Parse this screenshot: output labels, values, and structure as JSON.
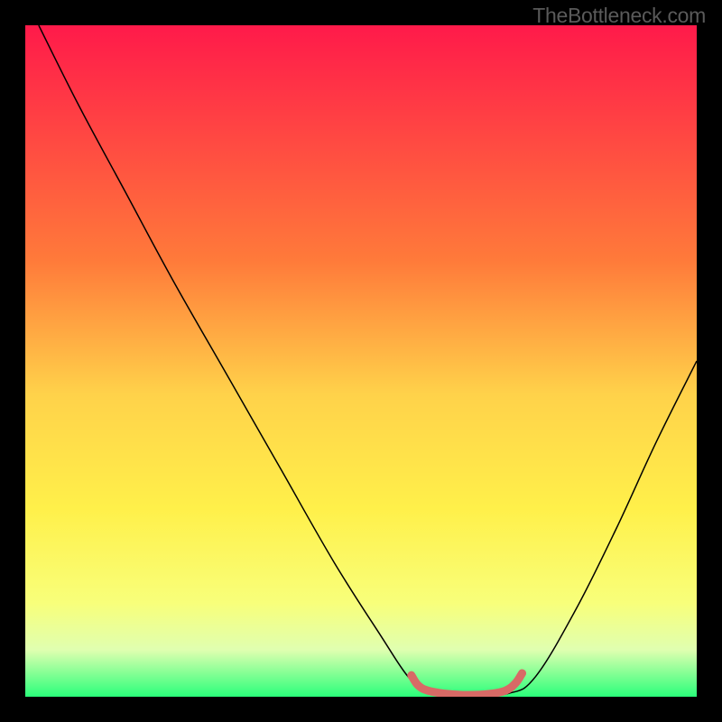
{
  "watermark": "TheBottleneck.com",
  "chart_data": {
    "type": "line",
    "title": "",
    "xlabel": "",
    "ylabel": "",
    "xlim": [
      0,
      100
    ],
    "ylim": [
      0,
      100
    ],
    "background_gradient": {
      "stops": [
        {
          "offset": 0,
          "color": "#ff1a4a"
        },
        {
          "offset": 35,
          "color": "#ff7a3a"
        },
        {
          "offset": 55,
          "color": "#ffd24a"
        },
        {
          "offset": 72,
          "color": "#fff04a"
        },
        {
          "offset": 86,
          "color": "#f8ff7a"
        },
        {
          "offset": 93,
          "color": "#e0ffb0"
        },
        {
          "offset": 100,
          "color": "#2aff7a"
        }
      ]
    },
    "series": [
      {
        "name": "bottleneck-curve",
        "type": "line",
        "color": "#000000",
        "width": 1.5,
        "points": [
          {
            "x": 2,
            "y": 100
          },
          {
            "x": 8,
            "y": 88
          },
          {
            "x": 15,
            "y": 75
          },
          {
            "x": 22,
            "y": 62
          },
          {
            "x": 30,
            "y": 48
          },
          {
            "x": 38,
            "y": 34
          },
          {
            "x": 46,
            "y": 20
          },
          {
            "x": 53,
            "y": 9
          },
          {
            "x": 57,
            "y": 3
          },
          {
            "x": 60,
            "y": 0.5
          },
          {
            "x": 66,
            "y": 0.2
          },
          {
            "x": 72,
            "y": 0.5
          },
          {
            "x": 76,
            "y": 3
          },
          {
            "x": 82,
            "y": 13
          },
          {
            "x": 88,
            "y": 25
          },
          {
            "x": 94,
            "y": 38
          },
          {
            "x": 100,
            "y": 50
          }
        ]
      },
      {
        "name": "optimal-zone-marker",
        "type": "line",
        "color": "#d86a66",
        "width": 9,
        "linecap": "round",
        "points": [
          {
            "x": 57.5,
            "y": 3.2
          },
          {
            "x": 58.5,
            "y": 1.7
          },
          {
            "x": 60,
            "y": 0.9
          },
          {
            "x": 63,
            "y": 0.4
          },
          {
            "x": 66,
            "y": 0.25
          },
          {
            "x": 69,
            "y": 0.4
          },
          {
            "x": 71.5,
            "y": 0.9
          },
          {
            "x": 73,
            "y": 2.0
          },
          {
            "x": 74,
            "y": 3.5
          }
        ]
      }
    ]
  }
}
